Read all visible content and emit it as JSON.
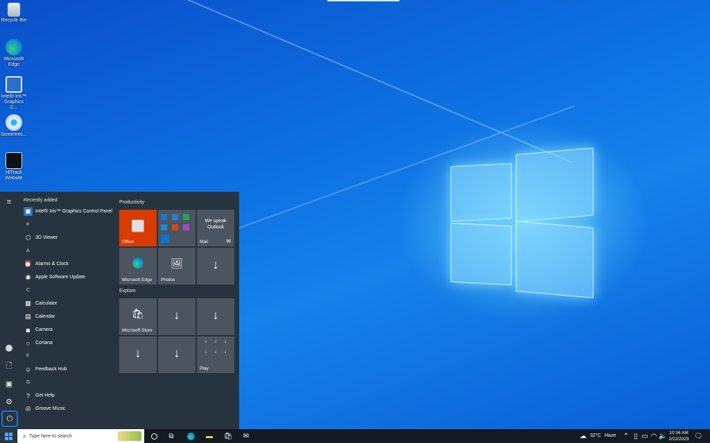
{
  "desktop": {
    "icons": [
      {
        "label": "Recycle Bin",
        "icon": "recycle-bin-icon"
      },
      {
        "label": "Microsoft Edge",
        "icon": "edge-icon"
      },
      {
        "label": "Intel® Iris™ Graphics C...",
        "icon": "intel-graphics-icon"
      },
      {
        "label": "Screenrec...",
        "icon": "screenrec-icon"
      },
      {
        "label": "HiTrack Website",
        "icon": "hitrack-icon"
      }
    ]
  },
  "start_menu": {
    "recently_added_header": "Recently added",
    "apps": [
      {
        "type": "app",
        "label": "Intel® Iris™ Graphics Control Panel",
        "icon": "intel-graphics-icon",
        "color": "#2a6fc9"
      },
      {
        "type": "letter",
        "label": "#"
      },
      {
        "type": "app",
        "label": "3D Viewer",
        "icon": "cube-icon",
        "color": "#273440"
      },
      {
        "type": "letter",
        "label": "A"
      },
      {
        "type": "app",
        "label": "Alarms & Clock",
        "icon": "alarm-clock-icon",
        "color": "#273440"
      },
      {
        "type": "app",
        "label": "Apple Software Update",
        "icon": "apple-update-icon",
        "color": "#273440"
      },
      {
        "type": "letter",
        "label": "C"
      },
      {
        "type": "app",
        "label": "Calculator",
        "icon": "calculator-icon",
        "color": "#273440"
      },
      {
        "type": "app",
        "label": "Calendar",
        "icon": "calendar-icon",
        "color": "#273440"
      },
      {
        "type": "app",
        "label": "Camera",
        "icon": "camera-icon",
        "color": "#273440"
      },
      {
        "type": "app",
        "label": "Cortana",
        "icon": "cortana-icon",
        "color": "#273440"
      },
      {
        "type": "letter",
        "label": "F"
      },
      {
        "type": "app",
        "label": "Feedback Hub",
        "icon": "feedback-icon",
        "color": "#273440"
      },
      {
        "type": "letter",
        "label": "G"
      },
      {
        "type": "app",
        "label": "Get Help",
        "icon": "help-icon",
        "color": "#273440"
      },
      {
        "type": "app",
        "label": "Groove Music",
        "icon": "groove-music-icon",
        "color": "#273440"
      }
    ],
    "groups": {
      "productivity": "Productivity",
      "explore": "Explore"
    },
    "tiles": {
      "office": "Office",
      "mail": "Mail",
      "mail_text": "We speak Outlook",
      "edge": "Microsoft Edge",
      "photos": "Photos",
      "store": "Microsoft Store",
      "play": "Play"
    }
  },
  "taskbar": {
    "search_placeholder": "Type here to search",
    "weather_temp": "32°C",
    "weather_text": "Haze",
    "time": "10:34 AM",
    "date": "2/22/2023"
  },
  "colors": {
    "office_tile": "#d83b01",
    "start_bg": "#273440",
    "tile_bg": "#4a5560",
    "accent": "#0078d4"
  }
}
